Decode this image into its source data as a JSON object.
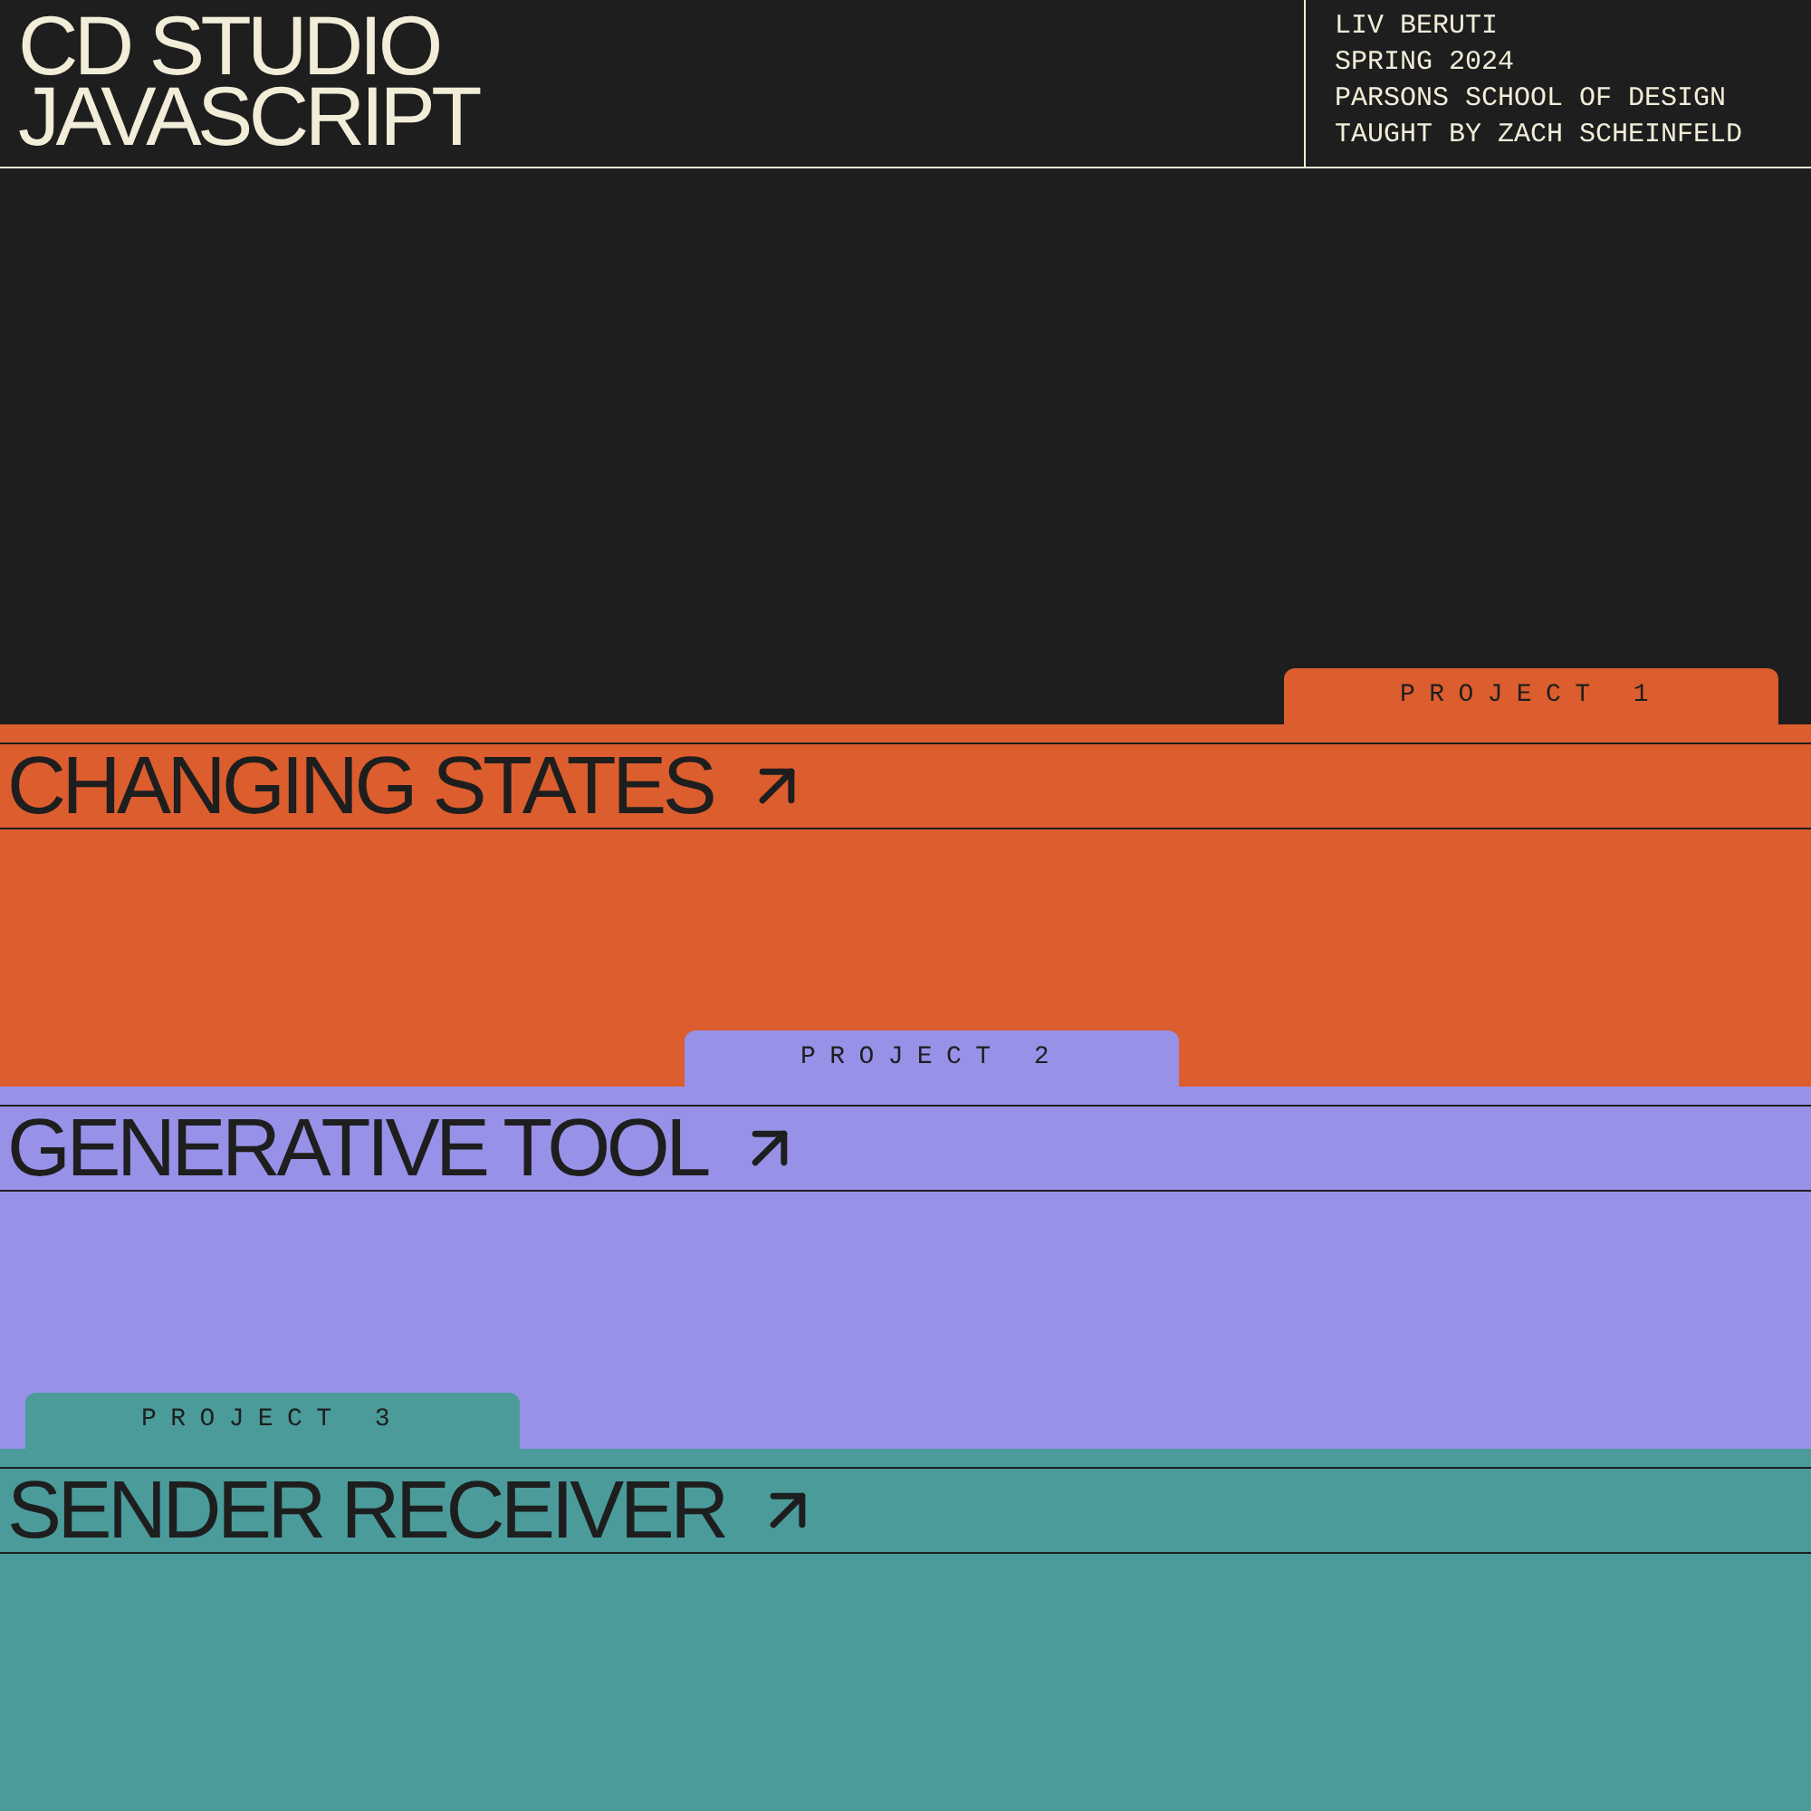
{
  "header": {
    "title": [
      "CD STUDIO",
      "JAVASCRIPT"
    ],
    "info": [
      "LIV BERUTI",
      "SPRING 2024",
      "PARSONS SCHOOL OF DESIGN",
      "TAUGHT BY ZACH SCHEINFELD"
    ]
  },
  "projects": [
    {
      "tab": "PROJECT 1",
      "title": "CHANGING STATES",
      "color": "#dc5d2e"
    },
    {
      "tab": "PROJECT 2",
      "title": "GENERATIVE TOOL",
      "color": "#9891e8"
    },
    {
      "tab": "PROJECT 3",
      "title": "SENDER RECEIVER",
      "color": "#4b9b9b"
    }
  ]
}
